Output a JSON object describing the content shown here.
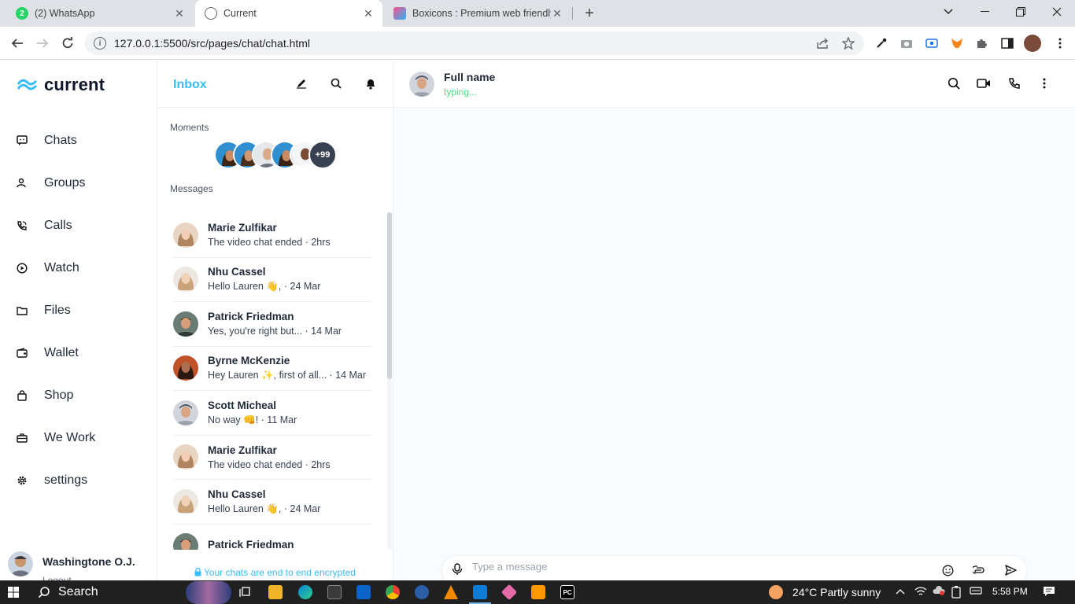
{
  "browser": {
    "tabs": [
      {
        "title": "(2) WhatsApp",
        "badge": "2"
      },
      {
        "title": "Current"
      },
      {
        "title": "Boxicons : Premium web friendly"
      }
    ],
    "url": "127.0.0.1:5500/src/pages/chat/chat.html"
  },
  "brand": {
    "name": "current",
    "color": "#38bdf8"
  },
  "nav": {
    "items": [
      {
        "label": "Chats",
        "icon": "chat-icon"
      },
      {
        "label": "Groups",
        "icon": "group-icon"
      },
      {
        "label": "Calls",
        "icon": "phone-call-icon"
      },
      {
        "label": "Watch",
        "icon": "play-circle-icon"
      },
      {
        "label": "Files",
        "icon": "folder-icon"
      },
      {
        "label": "Wallet",
        "icon": "wallet-icon"
      },
      {
        "label": "Shop",
        "icon": "shopping-bag-icon"
      },
      {
        "label": "We Work",
        "icon": "briefcase-icon"
      },
      {
        "label": "settings",
        "icon": "gear-icon"
      }
    ]
  },
  "user": {
    "name": "Washingtone O.J.",
    "logout": "Logout"
  },
  "inbox": {
    "title": "Inbox",
    "moments_label": "Moments",
    "moments_more": "+99",
    "messages_label": "Messages",
    "messages": [
      {
        "name": "Marie Zulfikar",
        "preview": "The video chat ended · 2hrs"
      },
      {
        "name": "Nhu Cassel",
        "preview": "Hello Lauren 👋, · 24 Mar"
      },
      {
        "name": "Patrick Friedman",
        "preview": "Yes, you're right but... · 14 Mar"
      },
      {
        "name": "Byrne McKenzie",
        "preview": "Hey Lauren ✨, first of all... · 14 Mar"
      },
      {
        "name": "Scott Micheal",
        "preview": "No way 👊! · 11 Mar"
      },
      {
        "name": "Marie Zulfikar",
        "preview": "The video chat ended · 2hrs"
      },
      {
        "name": "Nhu Cassel",
        "preview": "Hello Lauren 👋, · 24 Mar"
      },
      {
        "name": "Patrick Friedman",
        "preview": ""
      }
    ],
    "encrypted_note": "Your chats are end to end encrypted"
  },
  "chat": {
    "contact_name": "Full name",
    "status": "typing...",
    "composer_placeholder": "Type a message"
  },
  "taskbar": {
    "search": "Search",
    "weather": "24°C  Partly sunny",
    "time": "5:58 PM"
  }
}
